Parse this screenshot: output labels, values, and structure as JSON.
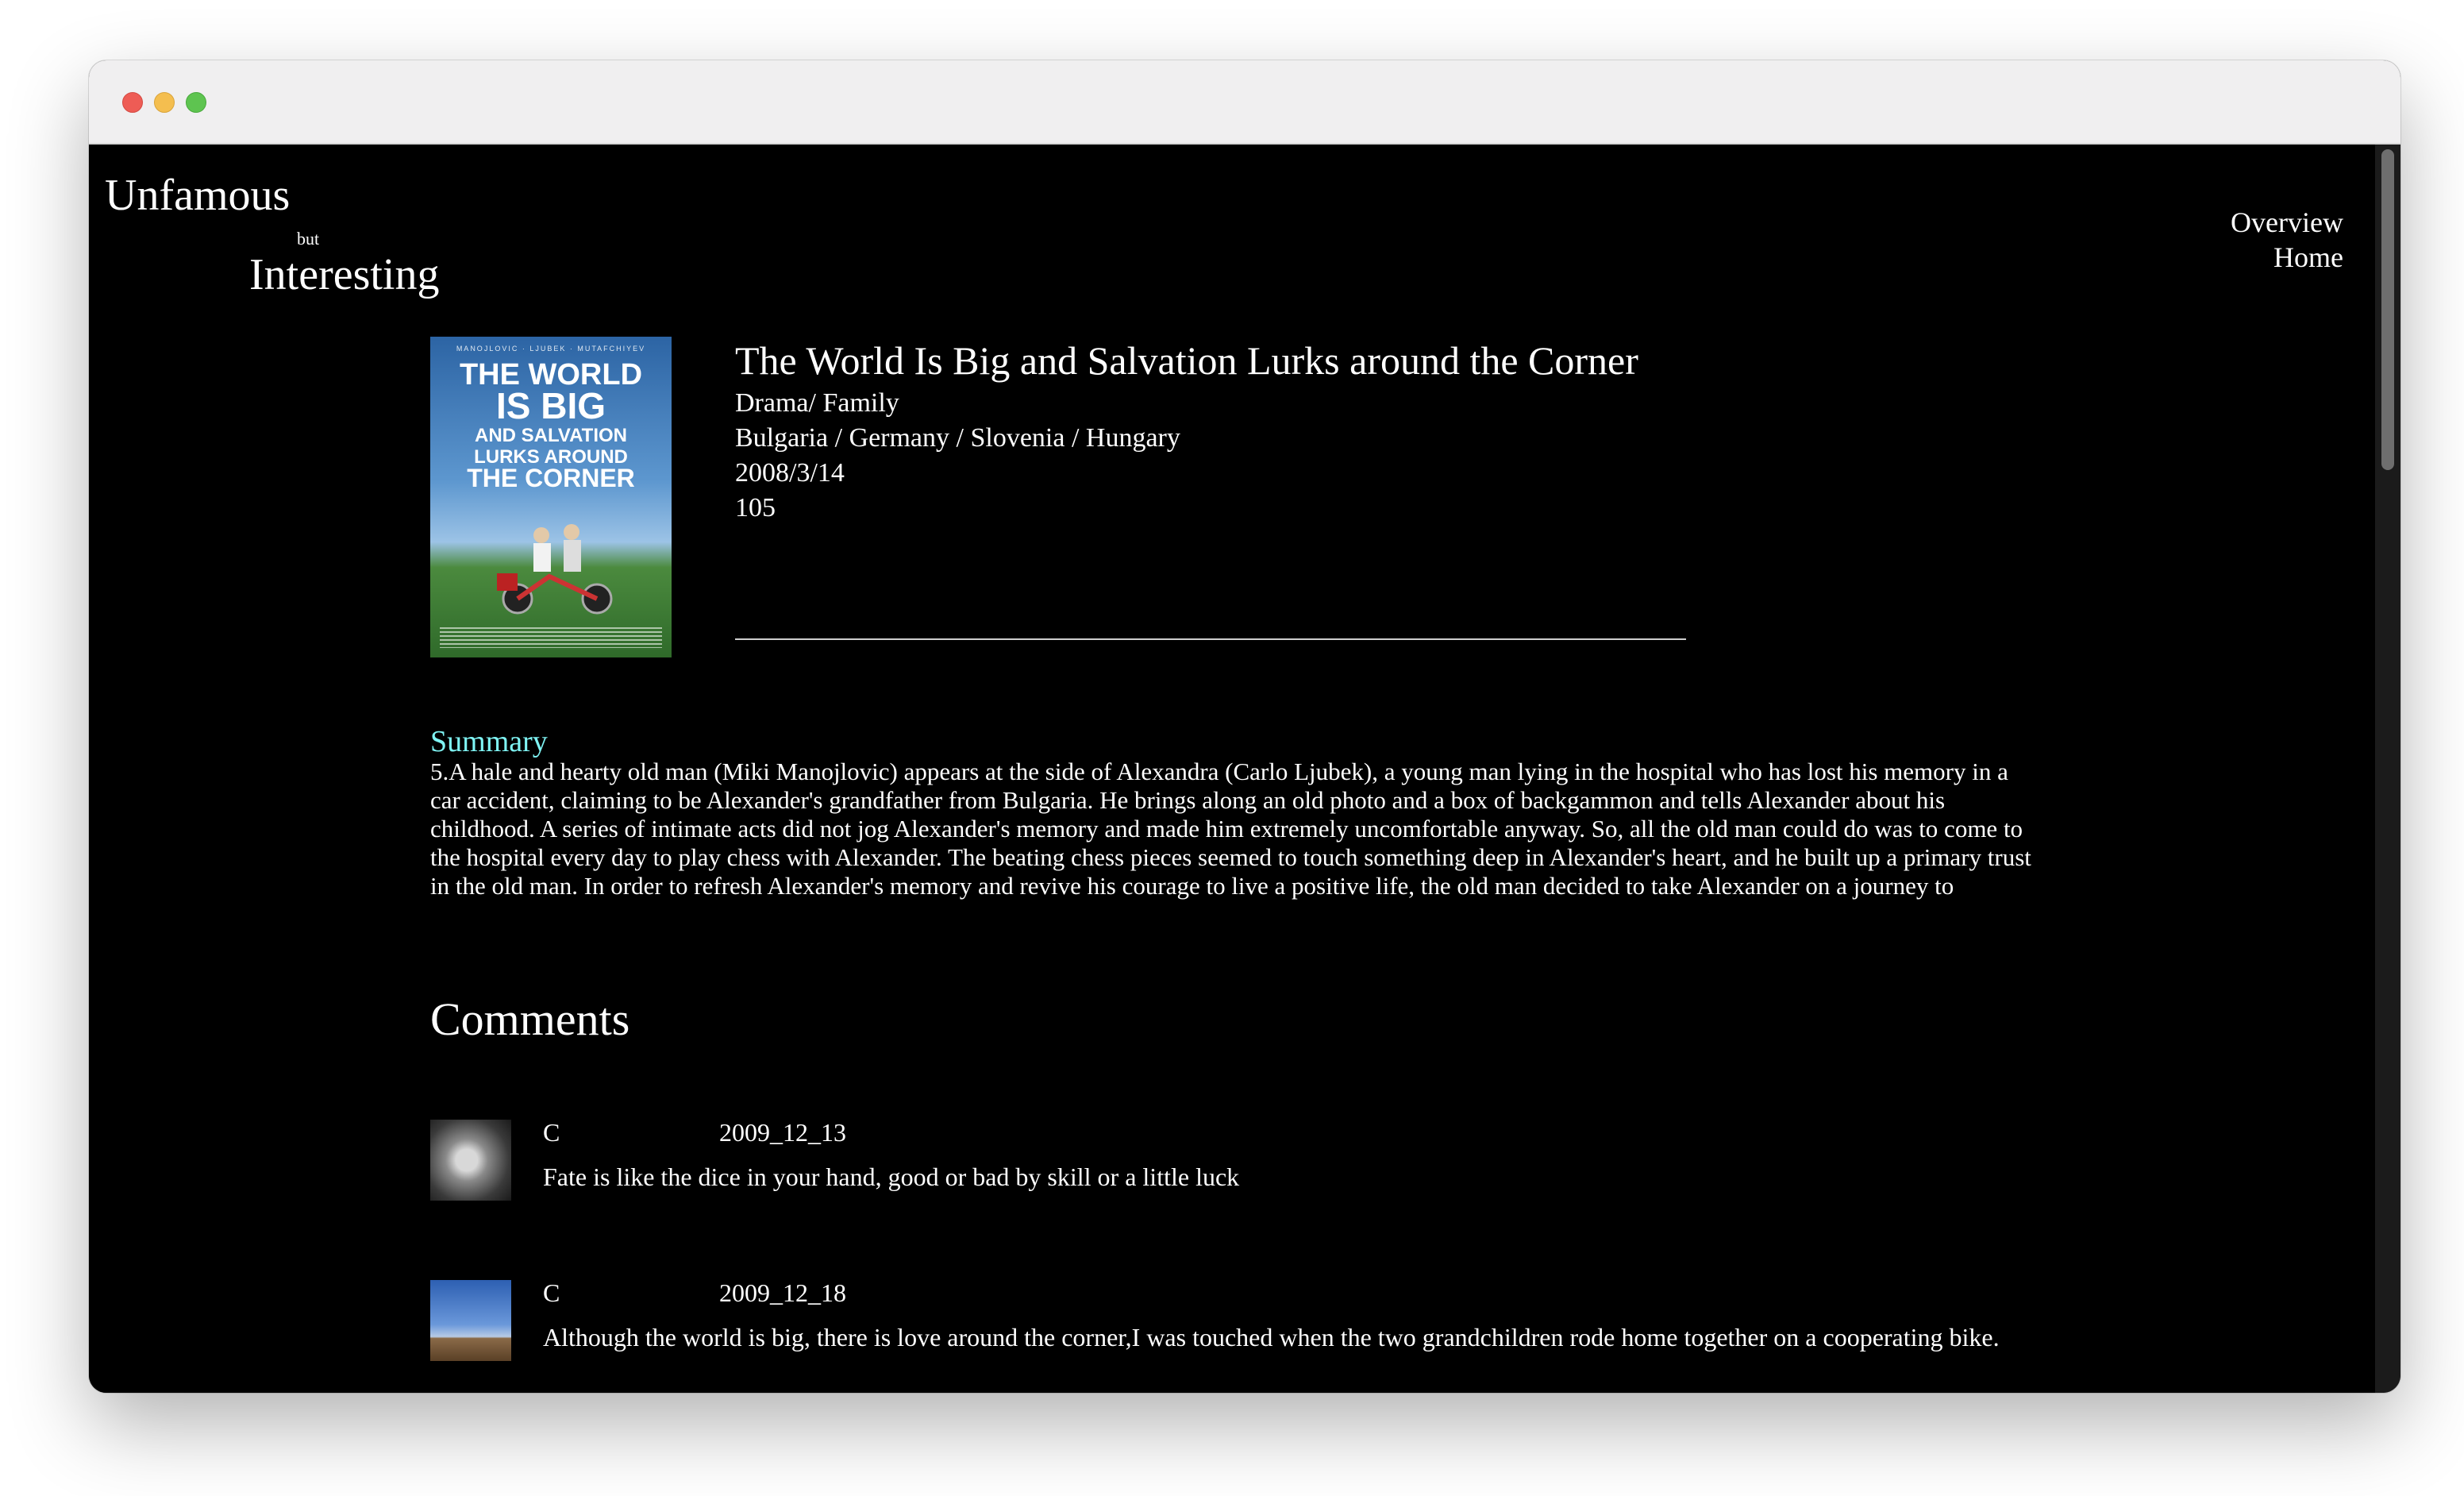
{
  "site": {
    "logo_top": "Unfamous",
    "logo_middle": "but",
    "logo_bottom": "Interesting"
  },
  "nav": {
    "overview": "Overview",
    "home": "Home"
  },
  "movie": {
    "title": "The World Is Big and Salvation Lurks around the Corner",
    "genre": "Drama/ Family",
    "countries": "Bulgaria / Germany / Slovenia / Hungary",
    "release_date": "2008/3/14",
    "runtime": "105",
    "poster": {
      "line1": "THE WORLD",
      "line2": "IS BIG",
      "line3": "AND SALVATION",
      "line4": "LURKS AROUND",
      "line5": "THE CORNER",
      "credits": "MANOJLOVIC · LJUBEK · MUTAFCHIYEV"
    }
  },
  "summary": {
    "heading": "Summary",
    "text": "5.A hale and hearty old man (Miki Manojlovic) appears at the side of Alexandra (Carlo Ljubek), a young man lying in the hospital who has lost his memory in a car accident, claiming to be Alexander's grandfather from Bulgaria. He brings along an old photo and a box of backgammon and tells Alexander about his childhood. A series of intimate acts did not jog Alexander's memory and made him extremely uncomfortable anyway. So, all the old man could do was to come to the hospital every day to play chess with Alexander. The beating chess pieces seemed to touch something deep in Alexander's heart, and he built up a primary trust in the old man. In order to refresh Alexander's memory and revive his courage to live a positive life, the old man decided to take Alexander on a journey to"
  },
  "comments": {
    "heading": "Comments",
    "items": [
      {
        "author": "C",
        "date": "2009_12_13",
        "text": "Fate is like the dice in your hand, good or bad by skill or a little luck"
      },
      {
        "author": "C",
        "date": "2009_12_18",
        "text": "Although the world is big, there is love around the corner,I was touched when the two grandchildren rode home together on a cooperating bike."
      }
    ]
  },
  "colors": {
    "background": "#000000",
    "text": "#ffffff",
    "summary_heading": "#7ff4f4"
  }
}
